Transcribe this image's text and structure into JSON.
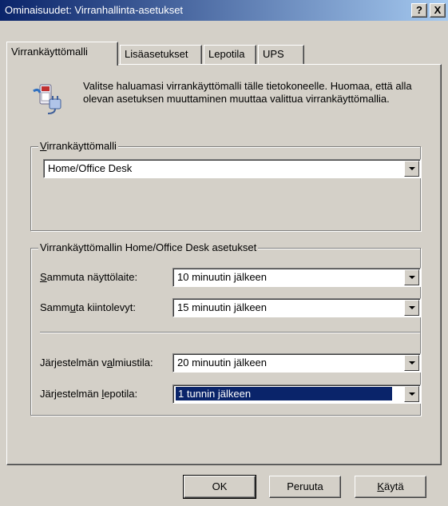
{
  "window": {
    "title": "Ominaisuudet: Virranhallinta-asetukset",
    "help_label": "?",
    "close_label": "X"
  },
  "tabs": [
    {
      "label": "Virrankäyttömalli"
    },
    {
      "label": "Lisäasetukset"
    },
    {
      "label": "Lepotila"
    },
    {
      "label": "UPS"
    }
  ],
  "description": "Valitse haluamasi virrankäyttömalli tälle tietokoneelle. Huomaa, että alla olevan asetuksen muuttaminen muuttaa valittua virrankäyttömallia.",
  "scheme_group": {
    "label_first": "V",
    "label_rest": "irrankäyttömalli",
    "selected": "Home/Office Desk"
  },
  "settings_group": {
    "label": "Virrankäyttömallin Home/Office Desk asetukset",
    "rows": [
      {
        "label_pre": "",
        "label_u": "S",
        "label_post": "ammuta näyttölaite:",
        "value": "10 minuutin jälkeen"
      },
      {
        "label_pre": "Samm",
        "label_u": "u",
        "label_post": "ta kiintolevyt:",
        "value": "15 minuutin jälkeen"
      },
      {
        "label_pre": "Järjestelmän v",
        "label_u": "a",
        "label_post": "lmiustila:",
        "value": "20 minuutin jälkeen"
      },
      {
        "label_pre": "Järjestelmän ",
        "label_u": "l",
        "label_post": "epotila:",
        "value": "1 tunnin jälkeen"
      }
    ]
  },
  "buttons": {
    "ok": "OK",
    "cancel": "Peruuta",
    "apply_u": "K",
    "apply_rest": "äytä"
  }
}
